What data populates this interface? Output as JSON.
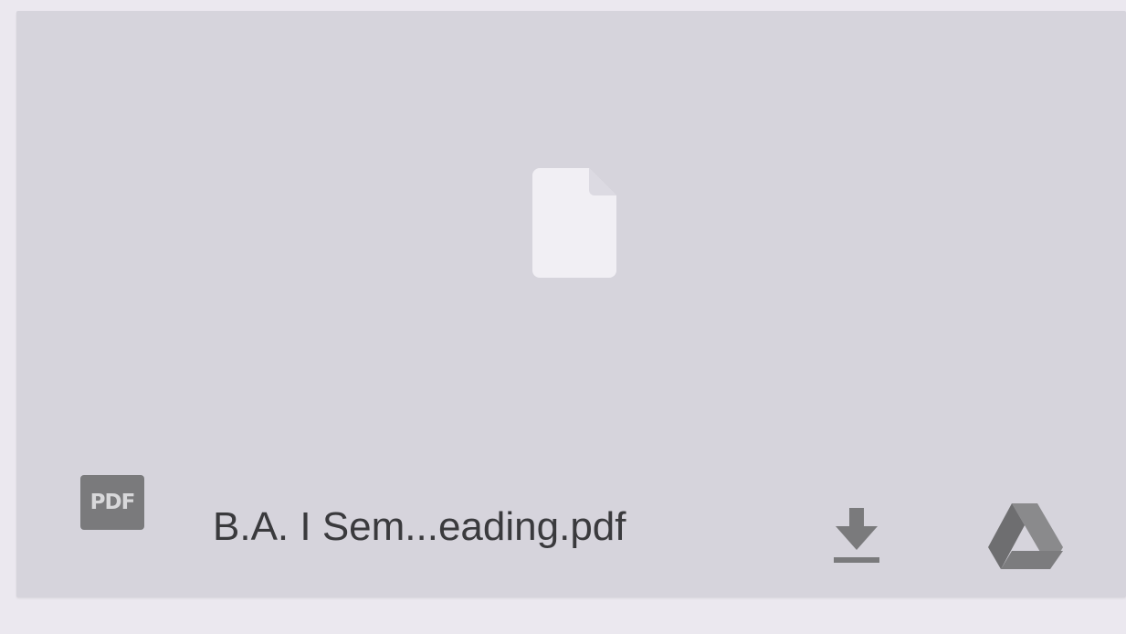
{
  "file": {
    "badge_label": "PDF",
    "name": "B.A. I Sem...eading.pdf"
  },
  "preview": {
    "icon": "document-icon"
  },
  "actions": {
    "download_icon": "download-icon",
    "drive_icon": "google-drive-icon"
  },
  "colors": {
    "background": "#ebe8ef",
    "card": "#d6d4dc",
    "icon_gray": "#7a7a7c",
    "preview_icon": "#f1eff4"
  }
}
